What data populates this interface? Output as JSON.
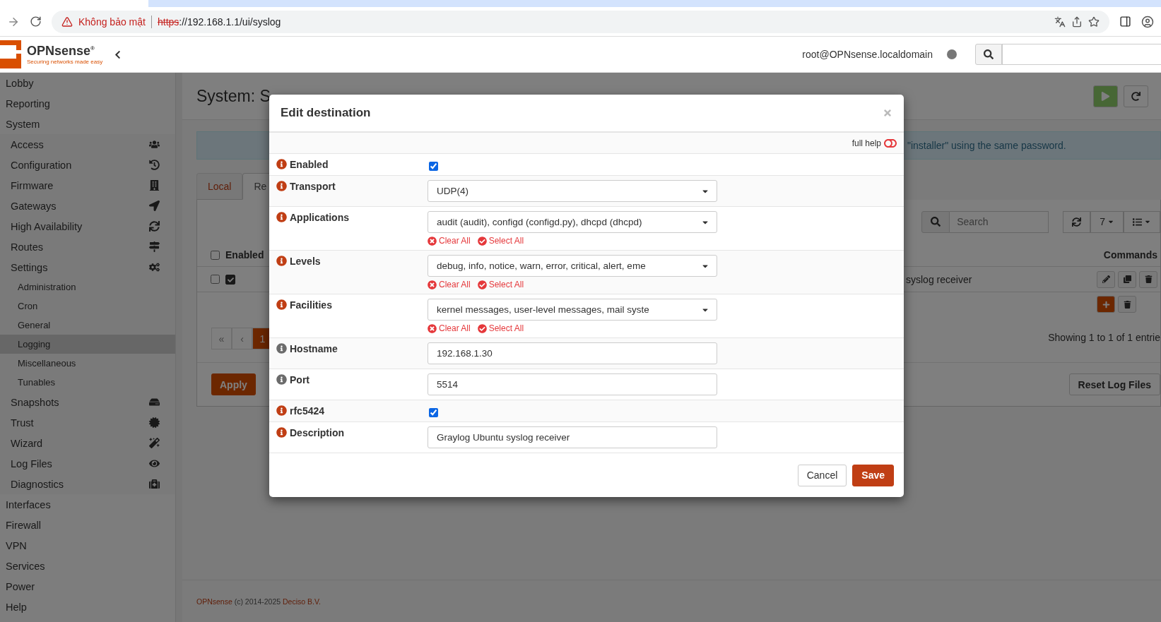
{
  "browser": {
    "warning_label": "Không bảo mật",
    "url": {
      "scheme": "https",
      "rest": "://192.168.1.1/ui/syslog"
    }
  },
  "header": {
    "brand": "OPNsense",
    "brand_mark": "®",
    "tagline": "Securing networks made easy",
    "user": "root@OPNsense.localdomain"
  },
  "sidebar": {
    "items": [
      {
        "label": "Lobby",
        "selected": false
      },
      {
        "label": "Reporting",
        "selected": false
      },
      {
        "label": "System",
        "selected": false,
        "children": [
          {
            "label": "Access",
            "selected": false
          },
          {
            "label": "Configuration",
            "selected": false
          },
          {
            "label": "Firmware",
            "selected": false
          },
          {
            "label": "Gateways",
            "selected": false
          },
          {
            "label": "High Availability",
            "selected": false
          },
          {
            "label": "Routes",
            "selected": false
          },
          {
            "label": "Settings",
            "selected": false,
            "children": [
              {
                "label": "Administration",
                "selected": false
              },
              {
                "label": "Cron",
                "selected": false
              },
              {
                "label": "General",
                "selected": false
              },
              {
                "label": "Logging",
                "selected": true
              },
              {
                "label": "Miscellaneous",
                "selected": false
              },
              {
                "label": "Tunables",
                "selected": false
              }
            ]
          },
          {
            "label": "Snapshots",
            "selected": false
          },
          {
            "label": "Trust",
            "selected": false
          },
          {
            "label": "Wizard",
            "selected": false
          },
          {
            "label": "Log Files",
            "selected": false
          },
          {
            "label": "Diagnostics",
            "selected": false
          }
        ]
      },
      {
        "label": "Interfaces",
        "selected": false
      },
      {
        "label": "Firewall",
        "selected": false
      },
      {
        "label": "VPN",
        "selected": false
      },
      {
        "label": "Services",
        "selected": false
      },
      {
        "label": "Power",
        "selected": false
      },
      {
        "label": "Help",
        "selected": false
      }
    ]
  },
  "page": {
    "title": "System: S",
    "notice": "\"installer\" using the same password.",
    "tabs": [
      {
        "label": "Local",
        "selected": false
      },
      {
        "label": "Re",
        "selected": true
      }
    ],
    "search": {
      "placeholder": "Search"
    },
    "page_size": "7",
    "table": {
      "columns": [
        {
          "label": "Enabled"
        },
        {
          "label": "Commands"
        }
      ],
      "select_all": false,
      "rows": [
        {
          "selected": false,
          "enabled": true,
          "description": "syslog receiver"
        }
      ]
    },
    "info": "Showing 1 to 1 of 1 entrie",
    "pagination": [
      {
        "label": "«",
        "selected": false
      },
      {
        "label": "‹",
        "selected": false
      },
      {
        "label": "1",
        "selected": true
      }
    ],
    "apply": "Apply",
    "reset": "Reset Log Files"
  },
  "footer": {
    "parts": [
      {
        "kind": "link",
        "text": "OPNsense"
      },
      {
        "kind": "text",
        "text": " (c) 2014-2025 "
      },
      {
        "kind": "link",
        "text": "Deciso B.V."
      }
    ]
  },
  "modal": {
    "title": "Edit destination",
    "help_label": "full help",
    "full_help": false,
    "fields": [
      {
        "kind": "checkbox",
        "label": "Enabled",
        "color": "#c03e14",
        "checked": true
      },
      {
        "kind": "select",
        "label": "Transport",
        "color": "#c03e14",
        "value": "UDP(4)"
      },
      {
        "kind": "multiselect",
        "label": "Applications",
        "color": "#c03e14",
        "value": "audit (audit), configd (configd.py), dhcpd (dhcpd)",
        "actions": [
          "Clear All",
          "Select All"
        ]
      },
      {
        "kind": "multiselect",
        "label": "Levels",
        "color": "#c03e14",
        "value": "debug, info, notice, warn, error, critical, alert, eme",
        "actions": [
          "Clear All",
          "Select All"
        ]
      },
      {
        "kind": "multiselect",
        "label": "Facilities",
        "color": "#c03e14",
        "value": "kernel messages, user-level messages, mail syste",
        "actions": [
          "Clear All",
          "Select All"
        ]
      },
      {
        "kind": "text",
        "label": "Hostname",
        "color": "#6b6b6b",
        "value": "192.168.1.30"
      },
      {
        "kind": "text",
        "label": "Port",
        "color": "#6b6b6b",
        "value": "5514"
      },
      {
        "kind": "checkbox",
        "label": "rfc5424",
        "color": "#c03e14",
        "checked": true
      },
      {
        "kind": "text",
        "label": "Description",
        "color": "#c03e14",
        "value": "Graylog Ubuntu syslog receiver"
      }
    ],
    "buttons": [
      {
        "kind": "default",
        "label": "Cancel"
      },
      {
        "kind": "primary",
        "label": "Save"
      }
    ]
  }
}
